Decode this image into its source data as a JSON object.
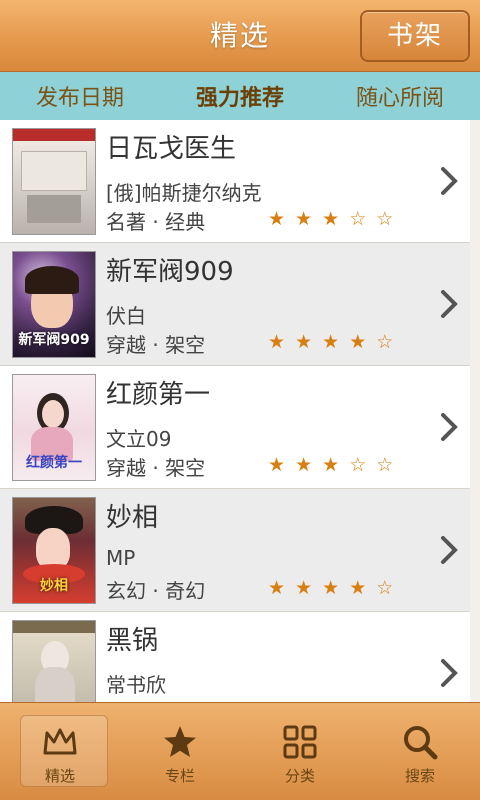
{
  "header": {
    "title": "精选",
    "shelf_button": "书架"
  },
  "subtabs": [
    {
      "label": "发布日期",
      "active": false
    },
    {
      "label": "强力推荐",
      "active": true
    },
    {
      "label": "随心所阅",
      "active": false
    }
  ],
  "books": [
    {
      "title": "日瓦戈医生",
      "author": "[俄]帕斯捷尔纳克",
      "category": "名著 · 经典",
      "stars": "★ ★ ★ ☆ ☆",
      "cover_text": ""
    },
    {
      "title": "新军阀909",
      "author": "伏白",
      "category": "穿越 · 架空",
      "stars": "★ ★ ★ ★ ☆",
      "cover_text": "新军阀909"
    },
    {
      "title": "红颜第一",
      "author": "文立09",
      "category": "穿越 · 架空",
      "stars": "★ ★ ★ ☆ ☆",
      "cover_text": "红颜第一"
    },
    {
      "title": "妙相",
      "author": "MP",
      "category": "玄幻 · 奇幻",
      "stars": "★ ★ ★ ★ ☆",
      "cover_text": "妙相"
    },
    {
      "title": "黑锅",
      "author": "常书欣",
      "category": "",
      "stars": "",
      "cover_text": ""
    }
  ],
  "bottom_nav": [
    {
      "label": "精选",
      "icon": "crown-icon",
      "active": true
    },
    {
      "label": "专栏",
      "icon": "star-icon",
      "active": false
    },
    {
      "label": "分类",
      "icon": "grid-icon",
      "active": false
    },
    {
      "label": "搜索",
      "icon": "search-icon",
      "active": false
    }
  ]
}
